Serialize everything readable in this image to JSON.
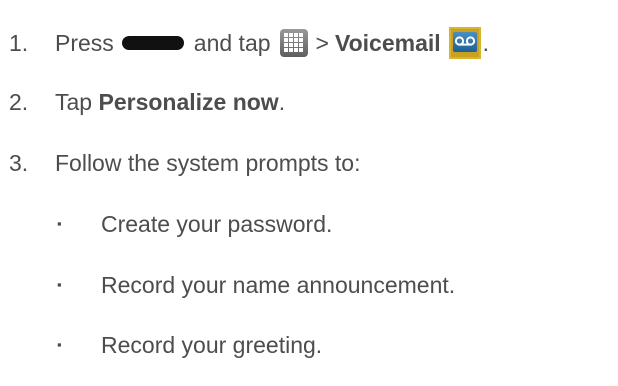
{
  "steps": [
    {
      "number": "1.",
      "text_press": "Press",
      "home_key_icon": "home-key-icon",
      "text_and_tap": "and tap",
      "apps_icon": "apps-grid-icon",
      "separator": ">",
      "target": "Voicemail",
      "voicemail_icon": "voicemail-icon",
      "end": "."
    },
    {
      "number": "2.",
      "text_tap": "Tap",
      "target": "Personalize now",
      "end": "."
    },
    {
      "number": "3.",
      "text": "Follow the system prompts to:"
    }
  ],
  "bullet_marker": "▪",
  "bullets": [
    "Create your password.",
    "Record your name announcement.",
    "Record your greeting."
  ],
  "colors": {
    "text": "#4d4d4d",
    "voicemail_icon_frame": "#c9a020",
    "voicemail_icon_face": "#2f73aa",
    "apps_icon": "#7a7a7a"
  }
}
